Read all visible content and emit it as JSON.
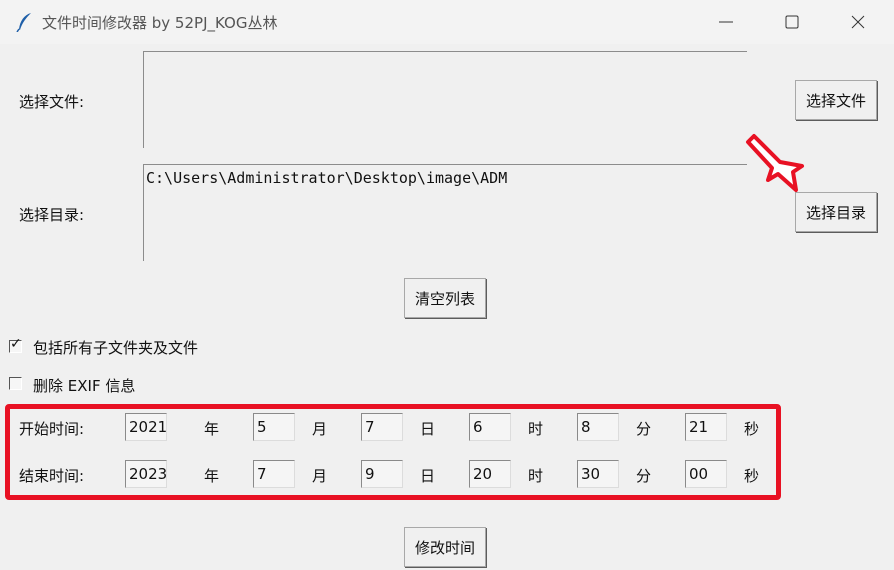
{
  "window": {
    "title": "文件时间修改器 by 52PJ_KOG丛林",
    "controls": [
      "minimize",
      "maximize",
      "close"
    ]
  },
  "file_row": {
    "label": "选择文件:",
    "value": "",
    "button": "选择文件"
  },
  "dir_row": {
    "label": "选择目录:",
    "value": "C:\\Users\\Administrator\\Desktop\\image\\ADM",
    "button": "选择目录"
  },
  "clear_button": "清空列表",
  "options": {
    "include_subfolders": {
      "label": "包括所有子文件夹及文件",
      "checked": true
    },
    "remove_exif": {
      "label": "删除 EXIF 信息",
      "checked": false
    }
  },
  "start_time": {
    "label": "开始时间:",
    "year": "2021",
    "month": "5",
    "day": "7",
    "hour": "6",
    "minute": "8",
    "second": "21"
  },
  "end_time": {
    "label": "结束时间:",
    "year": "2023",
    "month": "7",
    "day": "9",
    "hour": "20",
    "minute": "30",
    "second": "00"
  },
  "units": {
    "year": "年",
    "month": "月",
    "day": "日",
    "hour": "时",
    "minute": "分",
    "second": "秒"
  },
  "modify_button": "修改时间",
  "check_mark": "✓",
  "colors": {
    "highlight": "#e81123",
    "background": "#f0f0f0"
  },
  "icons": [
    "feather-icon",
    "minimize-icon",
    "maximize-icon",
    "close-icon",
    "red-arrow-icon"
  ]
}
